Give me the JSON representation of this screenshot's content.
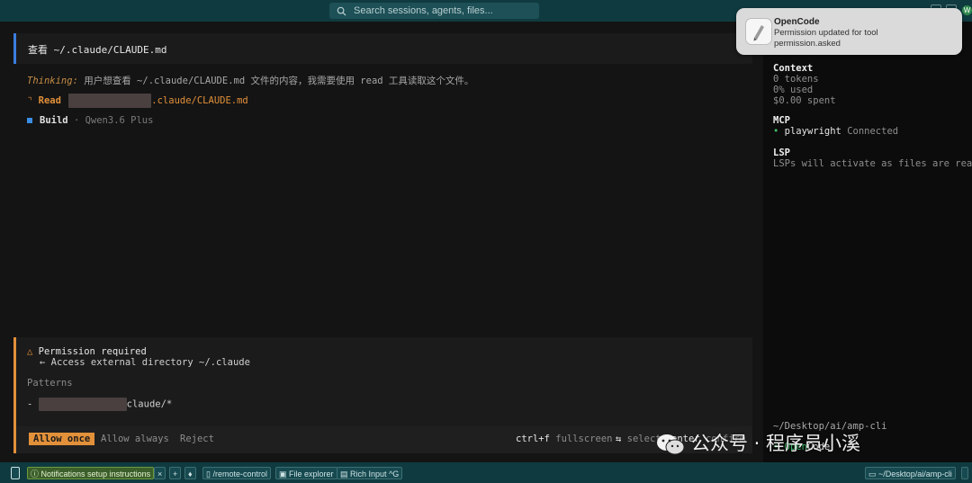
{
  "topbar": {
    "search_placeholder": "Search sessions, agents, files...",
    "avatar_letter": "W"
  },
  "notification": {
    "app": "OpenCode",
    "message_line1": "Permission updated for tool",
    "message_line2": "permission.asked"
  },
  "main": {
    "command_title": "查看 ~/.claude/CLAUDE.md",
    "thinking_label": "Thinking:",
    "thinking_text": "用户想查看 ~/.claude/CLAUDE.md 文件的内容，我需要使用 read 工具读取这个文件。",
    "read_marker": "⌝",
    "read_label": "Read",
    "read_path_suffix": ".claude/CLAUDE.md",
    "build_label": "Build",
    "build_sep": "·",
    "build_model": "Qwen3.6 Plus"
  },
  "permission": {
    "warn_icon": "△",
    "title": "Permission required",
    "arrow": "←",
    "subtitle": "Access external directory ~/.claude",
    "patterns_label": "Patterns",
    "pattern_dash": "-",
    "pattern_suffix": "claude/*",
    "options": [
      "Allow once",
      "Allow always",
      "Reject"
    ],
    "shortcuts": [
      {
        "key": "ctrl+f",
        "desc": "fullscreen"
      },
      {
        "key": "⇆",
        "desc": "select"
      },
      {
        "key": "enter",
        "desc": "confirm"
      }
    ]
  },
  "sidebar": {
    "context_heading": "Context",
    "tokens": "0 tokens",
    "used": "0% used",
    "spent": "$0.00 spent",
    "mcp_heading": "MCP",
    "mcp_bullet": "•",
    "mcp_server": "playwright",
    "mcp_status": "Connected",
    "lsp_heading": "LSP",
    "lsp_text": "LSPs will activate as files are read",
    "cwd": "~/Desktop/ai/amp-cli",
    "app_prefix": "• Open",
    "app_name": "Code"
  },
  "statusbar": {
    "notifications_chip": "Notifications setup instructions",
    "close_glyph": "×",
    "plus_glyph": "+",
    "remote_control": "/remote-control",
    "file_explorer": "File explorer",
    "rich_input": "Rich Input",
    "rich_input_shortcut": "^G",
    "cwd_chip": "~/Desktop/ai/amp-cli"
  },
  "watermark": {
    "text": "公众号 · 程序员小溪"
  },
  "colors": {
    "accent_orange": "#e2903a",
    "accent_blue": "#3a7de0",
    "connected_green": "#3fbf6b",
    "statusbar_teal": "#0f3b40"
  }
}
